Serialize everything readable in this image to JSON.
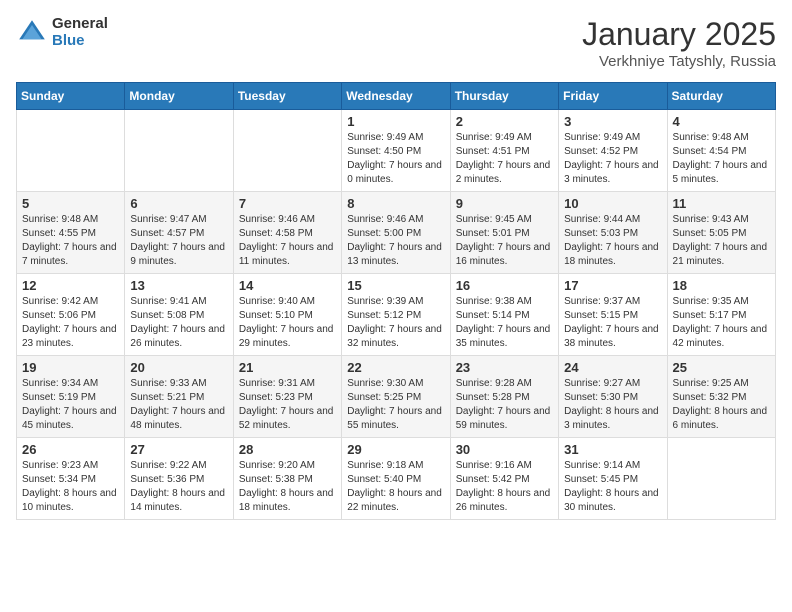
{
  "logo": {
    "general": "General",
    "blue": "Blue"
  },
  "header": {
    "month": "January 2025",
    "location": "Verkhniye Tatyshly, Russia"
  },
  "days_of_week": [
    "Sunday",
    "Monday",
    "Tuesday",
    "Wednesday",
    "Thursday",
    "Friday",
    "Saturday"
  ],
  "weeks": [
    [
      {
        "day": "",
        "info": ""
      },
      {
        "day": "",
        "info": ""
      },
      {
        "day": "",
        "info": ""
      },
      {
        "day": "1",
        "info": "Sunrise: 9:49 AM\nSunset: 4:50 PM\nDaylight: 7 hours and 0 minutes."
      },
      {
        "day": "2",
        "info": "Sunrise: 9:49 AM\nSunset: 4:51 PM\nDaylight: 7 hours and 2 minutes."
      },
      {
        "day": "3",
        "info": "Sunrise: 9:49 AM\nSunset: 4:52 PM\nDaylight: 7 hours and 3 minutes."
      },
      {
        "day": "4",
        "info": "Sunrise: 9:48 AM\nSunset: 4:54 PM\nDaylight: 7 hours and 5 minutes."
      }
    ],
    [
      {
        "day": "5",
        "info": "Sunrise: 9:48 AM\nSunset: 4:55 PM\nDaylight: 7 hours and 7 minutes."
      },
      {
        "day": "6",
        "info": "Sunrise: 9:47 AM\nSunset: 4:57 PM\nDaylight: 7 hours and 9 minutes."
      },
      {
        "day": "7",
        "info": "Sunrise: 9:46 AM\nSunset: 4:58 PM\nDaylight: 7 hours and 11 minutes."
      },
      {
        "day": "8",
        "info": "Sunrise: 9:46 AM\nSunset: 5:00 PM\nDaylight: 7 hours and 13 minutes."
      },
      {
        "day": "9",
        "info": "Sunrise: 9:45 AM\nSunset: 5:01 PM\nDaylight: 7 hours and 16 minutes."
      },
      {
        "day": "10",
        "info": "Sunrise: 9:44 AM\nSunset: 5:03 PM\nDaylight: 7 hours and 18 minutes."
      },
      {
        "day": "11",
        "info": "Sunrise: 9:43 AM\nSunset: 5:05 PM\nDaylight: 7 hours and 21 minutes."
      }
    ],
    [
      {
        "day": "12",
        "info": "Sunrise: 9:42 AM\nSunset: 5:06 PM\nDaylight: 7 hours and 23 minutes."
      },
      {
        "day": "13",
        "info": "Sunrise: 9:41 AM\nSunset: 5:08 PM\nDaylight: 7 hours and 26 minutes."
      },
      {
        "day": "14",
        "info": "Sunrise: 9:40 AM\nSunset: 5:10 PM\nDaylight: 7 hours and 29 minutes."
      },
      {
        "day": "15",
        "info": "Sunrise: 9:39 AM\nSunset: 5:12 PM\nDaylight: 7 hours and 32 minutes."
      },
      {
        "day": "16",
        "info": "Sunrise: 9:38 AM\nSunset: 5:14 PM\nDaylight: 7 hours and 35 minutes."
      },
      {
        "day": "17",
        "info": "Sunrise: 9:37 AM\nSunset: 5:15 PM\nDaylight: 7 hours and 38 minutes."
      },
      {
        "day": "18",
        "info": "Sunrise: 9:35 AM\nSunset: 5:17 PM\nDaylight: 7 hours and 42 minutes."
      }
    ],
    [
      {
        "day": "19",
        "info": "Sunrise: 9:34 AM\nSunset: 5:19 PM\nDaylight: 7 hours and 45 minutes."
      },
      {
        "day": "20",
        "info": "Sunrise: 9:33 AM\nSunset: 5:21 PM\nDaylight: 7 hours and 48 minutes."
      },
      {
        "day": "21",
        "info": "Sunrise: 9:31 AM\nSunset: 5:23 PM\nDaylight: 7 hours and 52 minutes."
      },
      {
        "day": "22",
        "info": "Sunrise: 9:30 AM\nSunset: 5:25 PM\nDaylight: 7 hours and 55 minutes."
      },
      {
        "day": "23",
        "info": "Sunrise: 9:28 AM\nSunset: 5:28 PM\nDaylight: 7 hours and 59 minutes."
      },
      {
        "day": "24",
        "info": "Sunrise: 9:27 AM\nSunset: 5:30 PM\nDaylight: 8 hours and 3 minutes."
      },
      {
        "day": "25",
        "info": "Sunrise: 9:25 AM\nSunset: 5:32 PM\nDaylight: 8 hours and 6 minutes."
      }
    ],
    [
      {
        "day": "26",
        "info": "Sunrise: 9:23 AM\nSunset: 5:34 PM\nDaylight: 8 hours and 10 minutes."
      },
      {
        "day": "27",
        "info": "Sunrise: 9:22 AM\nSunset: 5:36 PM\nDaylight: 8 hours and 14 minutes."
      },
      {
        "day": "28",
        "info": "Sunrise: 9:20 AM\nSunset: 5:38 PM\nDaylight: 8 hours and 18 minutes."
      },
      {
        "day": "29",
        "info": "Sunrise: 9:18 AM\nSunset: 5:40 PM\nDaylight: 8 hours and 22 minutes."
      },
      {
        "day": "30",
        "info": "Sunrise: 9:16 AM\nSunset: 5:42 PM\nDaylight: 8 hours and 26 minutes."
      },
      {
        "day": "31",
        "info": "Sunrise: 9:14 AM\nSunset: 5:45 PM\nDaylight: 8 hours and 30 minutes."
      },
      {
        "day": "",
        "info": ""
      }
    ]
  ]
}
